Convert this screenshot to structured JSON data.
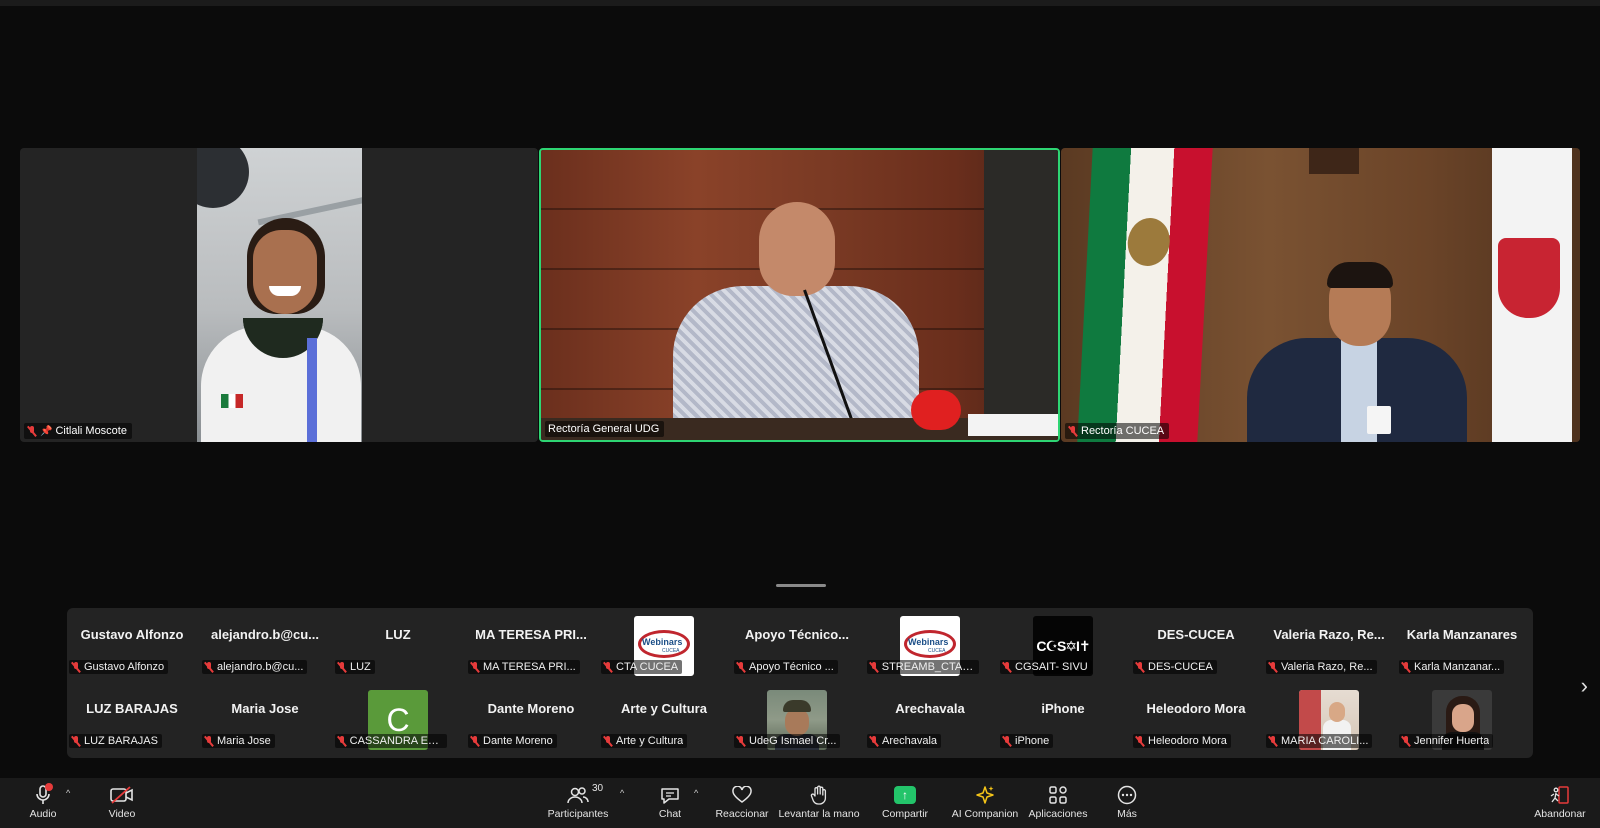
{
  "gallery": {
    "tiles": [
      {
        "name": "Citlali Moscote",
        "muted": true,
        "pinned": true
      },
      {
        "name": "Rectoría General UDG",
        "muted": false,
        "active_speaker": true
      },
      {
        "name": "Rectoría CUCEA",
        "muted": true
      }
    ]
  },
  "participants_strip": {
    "row1": [
      {
        "display": "Gustavo Alfonzo",
        "label": "Gustavo Alfonzo"
      },
      {
        "display": "alejandro.b@cu...",
        "label": "alejandro.b@cu..."
      },
      {
        "display": "LUZ",
        "label": "LUZ"
      },
      {
        "display": "MA TERESA PRI...",
        "label": "MA TERESA PRI..."
      },
      {
        "display": "",
        "label": "CTA CUCEA",
        "avatar": "webinars-logo",
        "avatar_text": "Webinars",
        "avatar_sub": "CUCEA"
      },
      {
        "display": "Apoyo  Técnico...",
        "label": "Apoyo Técnico ..."
      },
      {
        "display": "",
        "label": "STREAMB_CTA_...",
        "avatar": "webinars-logo",
        "avatar_text": "Webinars",
        "avatar_sub": "CUCEA"
      },
      {
        "display": "",
        "label": "CGSAIT- SIVU",
        "avatar": "coexist-logo",
        "avatar_text": "C☪S✡I✝"
      },
      {
        "display": "DES-CUCEA",
        "label": "DES-CUCEA"
      },
      {
        "display": "Valeria  Razo,  Re...",
        "label": "Valeria Razo, Re..."
      },
      {
        "display": "Karla Manzanares",
        "label": "Karla Manzanar..."
      }
    ],
    "row2": [
      {
        "display": "LUZ BARAJAS",
        "label": "LUZ BARAJAS"
      },
      {
        "display": "Maria Jose",
        "label": "Maria Jose"
      },
      {
        "display": "",
        "label": "CASSANDRA ELI...",
        "avatar": "letter",
        "avatar_text": "C"
      },
      {
        "display": "Dante Moreno",
        "label": "Dante Moreno"
      },
      {
        "display": "Arte y Cultura",
        "label": "Arte y Cultura"
      },
      {
        "display": "",
        "label": "UdeG Ismael Cr...",
        "avatar": "photo-man"
      },
      {
        "display": "Arechavala",
        "label": "Arechavala"
      },
      {
        "display": "iPhone",
        "label": "iPhone"
      },
      {
        "display": "Heleodoro Mora",
        "label": "Heleodoro Mora"
      },
      {
        "display": "",
        "label": "MARIA CAROLI...",
        "avatar": "photo-woman"
      },
      {
        "display": "",
        "label": "Jennifer Huerta",
        "avatar": "photo-woman2"
      }
    ]
  },
  "toolbar": {
    "audio": "Audio",
    "video": "Video",
    "participants": "Participantes",
    "participants_count": "30",
    "chat": "Chat",
    "react": "Reaccionar",
    "raise_hand": "Levantar la mano",
    "share": "Compartir",
    "ai_companion": "AI Companion",
    "apps": "Aplicaciones",
    "more": "Más",
    "leave": "Abandonar"
  },
  "colors": {
    "active_speaker_border": "#2ed573",
    "muted_icon": "#e63b3b",
    "share_accent": "#23c46a",
    "ai_accent": "#f5c518"
  }
}
